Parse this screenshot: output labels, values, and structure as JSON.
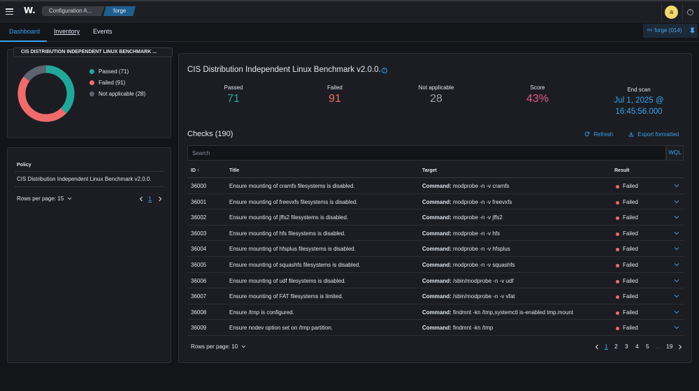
{
  "topbar": {
    "logo": "W.",
    "breadcrumb": [
      "Configuration A...",
      "forge"
    ],
    "avatar_letter": "a",
    "help_symbol": "?"
  },
  "tabs": [
    "Dashboard",
    "Inventory",
    "Events"
  ],
  "agent_pill": {
    "label": "forge (014)",
    "icon": "radio-icon",
    "pin_icon": "pin-icon"
  },
  "chart_panel": {
    "title": "CIS DISTRIBUTION INDEPENDENT LINUX BENCHMARK ...",
    "chart_data": {
      "type": "pie",
      "donut": true,
      "categories": [
        "Passed",
        "Failed",
        "Not applicable"
      ],
      "values": [
        71,
        91,
        28
      ],
      "colors": [
        "#20a99b",
        "#f16b6b",
        "#5d6470"
      ]
    },
    "legend": [
      "Passed (71)",
      "Failed (91)",
      "Not applicable (28)"
    ]
  },
  "policy_panel": {
    "column_header": "Policy",
    "rows": [
      "CIS Distribution Independent Linux Benchmark v2.0.0."
    ],
    "rows_per_page": "Rows per page: 15",
    "page": "1"
  },
  "main": {
    "title": "CIS Distribution Independent Linux Benchmark v2.0.0.",
    "stats": [
      {
        "label": "Passed",
        "value": "71",
        "color": "#20a99b"
      },
      {
        "label": "Failed",
        "value": "91",
        "color": "#f16b6b"
      },
      {
        "label": "Not applicable",
        "value": "28",
        "color": "#9aa0aa"
      },
      {
        "label": "Score",
        "value": "43%",
        "color": "#e05886"
      }
    ],
    "end_scan": {
      "label": "End scan",
      "line1": "Jul 1, 2025 @",
      "line2": "16:45:56.000"
    },
    "checks_title": "Checks (190)",
    "refresh_label": "Refresh",
    "export_label": "Export formatted",
    "search_placeholder": "Search",
    "wql_label": "WQL",
    "table": {
      "headers": [
        "ID ↑",
        "Title",
        "Target",
        "Result"
      ],
      "target_prefix": "Command:",
      "rows": [
        {
          "id": "36000",
          "title": "Ensure mounting of cramfs filesystems is disabled.",
          "target": "modprobe -n -v cramfs",
          "result": "Failed"
        },
        {
          "id": "36001",
          "title": "Ensure mounting of freevxfs filesystems is disabled.",
          "target": "modprobe -n -v freevxfs",
          "result": "Failed"
        },
        {
          "id": "36002",
          "title": "Ensure mounting of jffs2 filesystems is disabled.",
          "target": "modprobe -n -v jffs2",
          "result": "Failed"
        },
        {
          "id": "36003",
          "title": "Ensure mounting of hfs filesystems is disabled.",
          "target": "modprobe -n -v hfs",
          "result": "Failed"
        },
        {
          "id": "36004",
          "title": "Ensure mounting of hfsplus filesystems is disabled.",
          "target": "modprobe -n -v hfsplus",
          "result": "Failed"
        },
        {
          "id": "36005",
          "title": "Ensure mounting of squashfs filesystems is disabled.",
          "target": "modprobe -n -v squashfs",
          "result": "Failed"
        },
        {
          "id": "36006",
          "title": "Ensure mounting of udf filesystems is disabled.",
          "target": "/sbin/modprobe -n -v udf",
          "result": "Failed"
        },
        {
          "id": "36007",
          "title": "Ensure mounting of FAT filesystems is limited.",
          "target": "/sbin/modprobe -n -v vfat",
          "result": "Failed"
        },
        {
          "id": "36008",
          "title": "Ensure /tmp is configured.",
          "target": "findmnt -kn /tmp,systemctl is-enabled tmp.mount",
          "result": "Failed"
        },
        {
          "id": "36009",
          "title": "Ensure nodev option set on /tmp partition.",
          "target": "findmnt -kn /tmp",
          "result": "Failed"
        }
      ]
    },
    "rows_per_page": "Rows per page: 10",
    "pagination": [
      "1",
      "2",
      "3",
      "4",
      "5",
      "...",
      "19"
    ],
    "pagination_current": "1"
  }
}
